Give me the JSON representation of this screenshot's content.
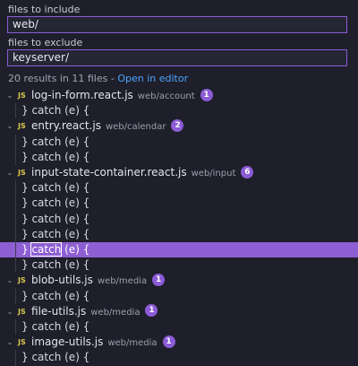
{
  "include": {
    "label": "files to include",
    "value": "web/"
  },
  "exclude": {
    "label": "files to exclude",
    "value": "keyserver/"
  },
  "summary": {
    "text": "20 results in 11 files - ",
    "link": "Open in editor"
  },
  "results": [
    {
      "type": "file",
      "name": "log-in-form.react.js",
      "path": "web/account",
      "count": "1",
      "icon": "js-file-icon"
    },
    {
      "type": "match",
      "text": "} catch (e) {"
    },
    {
      "type": "file",
      "name": "entry.react.js",
      "path": "web/calendar",
      "count": "2",
      "icon": "js-file-icon"
    },
    {
      "type": "match",
      "text": "} catch (e) {"
    },
    {
      "type": "match",
      "text": "} catch (e) {"
    },
    {
      "type": "file",
      "name": "input-state-container.react.js",
      "path": "web/input",
      "count": "6",
      "icon": "js-file-icon"
    },
    {
      "type": "match",
      "text": "} catch (e) {"
    },
    {
      "type": "match",
      "text": "} catch (e) {"
    },
    {
      "type": "match",
      "text": "} catch (e) {"
    },
    {
      "type": "match",
      "text": "} catch (e) {"
    },
    {
      "type": "match",
      "text": "} catch (e) {",
      "selected": true
    },
    {
      "type": "match",
      "text": "} catch (e) {"
    },
    {
      "type": "file",
      "name": "blob-utils.js",
      "path": "web/media",
      "count": "1",
      "icon": "js-file-icon"
    },
    {
      "type": "match",
      "text": "} catch (e) {"
    },
    {
      "type": "file",
      "name": "file-utils.js",
      "path": "web/media",
      "count": "1",
      "icon": "js-file-icon"
    },
    {
      "type": "match",
      "text": "} catch (e) {"
    },
    {
      "type": "file",
      "name": "image-utils.js",
      "path": "web/media",
      "count": "1",
      "icon": "js-file-icon"
    },
    {
      "type": "match",
      "text": "} catch (e) {"
    }
  ],
  "js_label": "JS",
  "colors": {
    "accent": "#8c5bd6",
    "selection": "#8e5fd3",
    "link": "#4da3ff",
    "js": "#d9c84c"
  }
}
